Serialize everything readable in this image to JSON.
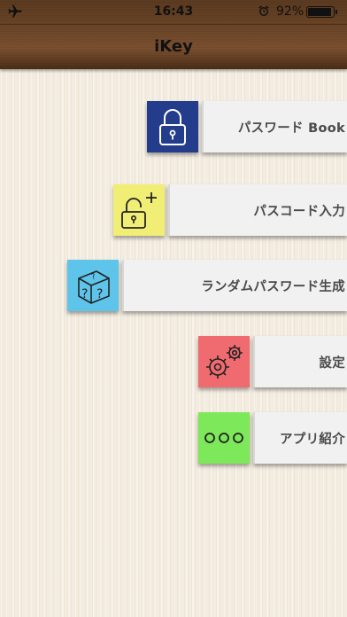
{
  "status_bar": {
    "time": "16:43",
    "battery_percent": "92%",
    "battery_level": 0.92
  },
  "nav": {
    "title": "iKey"
  },
  "menu": [
    {
      "label": "パスワード Book",
      "icon": "lock-icon",
      "color": "#233d8c"
    },
    {
      "label": "パスコード入力",
      "icon": "unlock-plus-icon",
      "color": "#f0ee74"
    },
    {
      "label": "ランダムパスワード生成",
      "icon": "question-cube-icon",
      "color": "#5fc4ea"
    },
    {
      "label": "設定",
      "icon": "gears-icon",
      "color": "#f06b70"
    },
    {
      "label": "アプリ紹介",
      "icon": "dots-icon",
      "color": "#7de859"
    }
  ]
}
